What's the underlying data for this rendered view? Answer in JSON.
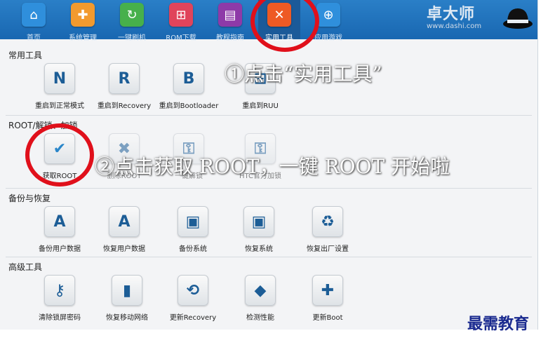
{
  "nav": {
    "items": [
      {
        "label": "首页",
        "icon": "home-icon",
        "glyph": "⌂",
        "color": "#2f8fdc"
      },
      {
        "label": "系统管理",
        "icon": "toolbox-icon",
        "glyph": "✚",
        "color": "#f29a2e"
      },
      {
        "label": "一键刷机",
        "icon": "refresh-icon",
        "glyph": "↻",
        "color": "#47b04b"
      },
      {
        "label": "ROM下载",
        "icon": "cart-icon",
        "glyph": "⊞",
        "color": "#e0445b"
      },
      {
        "label": "教程指南",
        "icon": "book-icon",
        "glyph": "▤",
        "color": "#8e3aa8"
      },
      {
        "label": "实用工具",
        "icon": "tools-icon",
        "glyph": "✕",
        "color": "#ee5a24"
      },
      {
        "label": "应用游戏",
        "icon": "gamepad-icon",
        "glyph": "⊕",
        "color": "#2f8fdc"
      }
    ],
    "active_index": 5
  },
  "brand": {
    "name": "卓大师",
    "url": "www.dashi.com"
  },
  "sections": {
    "common": {
      "title": "常用工具",
      "tools": [
        {
          "label": "重启到正常模式",
          "glyph": "N"
        },
        {
          "label": "重启到Recovery",
          "glyph": "R"
        },
        {
          "label": "重启到Bootloader",
          "glyph": "B"
        },
        {
          "label": "重启到RUU",
          "glyph": "⊞"
        }
      ]
    },
    "root": {
      "title": "ROOT/解锁、加锁",
      "tools": [
        {
          "label": "获取ROOT",
          "glyph": "✔"
        },
        {
          "label": "删除ROOT",
          "glyph": "✖"
        },
        {
          "label": "一键解锁",
          "glyph": "⚿"
        },
        {
          "label": "HTC官方加锁",
          "glyph": "⚿"
        }
      ]
    },
    "backup": {
      "title": "备份与恢复",
      "tools": [
        {
          "label": "备份用户数据",
          "glyph": "A"
        },
        {
          "label": "恢复用户数据",
          "glyph": "A"
        },
        {
          "label": "备份系统",
          "glyph": "▣"
        },
        {
          "label": "恢复系统",
          "glyph": "▣"
        },
        {
          "label": "恢复出厂设置",
          "glyph": "♻"
        }
      ]
    },
    "advanced": {
      "title": "高级工具",
      "tools": [
        {
          "label": "清除锁屏密码",
          "glyph": "⚷"
        },
        {
          "label": "恢复移动网络",
          "glyph": "▮"
        },
        {
          "label": "更新Recovery",
          "glyph": "⟲"
        },
        {
          "label": "检测性能",
          "glyph": "◆"
        },
        {
          "label": "更新Boot",
          "glyph": "✚"
        }
      ]
    }
  },
  "annotations": {
    "step1": "①点击“实用工具”",
    "step2": "②点击获取 ROOT，一键 ROOT 开始啦"
  },
  "watermark": "最需教育",
  "colors": {
    "nav_bg": "#1f6fbb",
    "highlight_ring": "#e0101b",
    "watermark": "#1a2a8f"
  }
}
